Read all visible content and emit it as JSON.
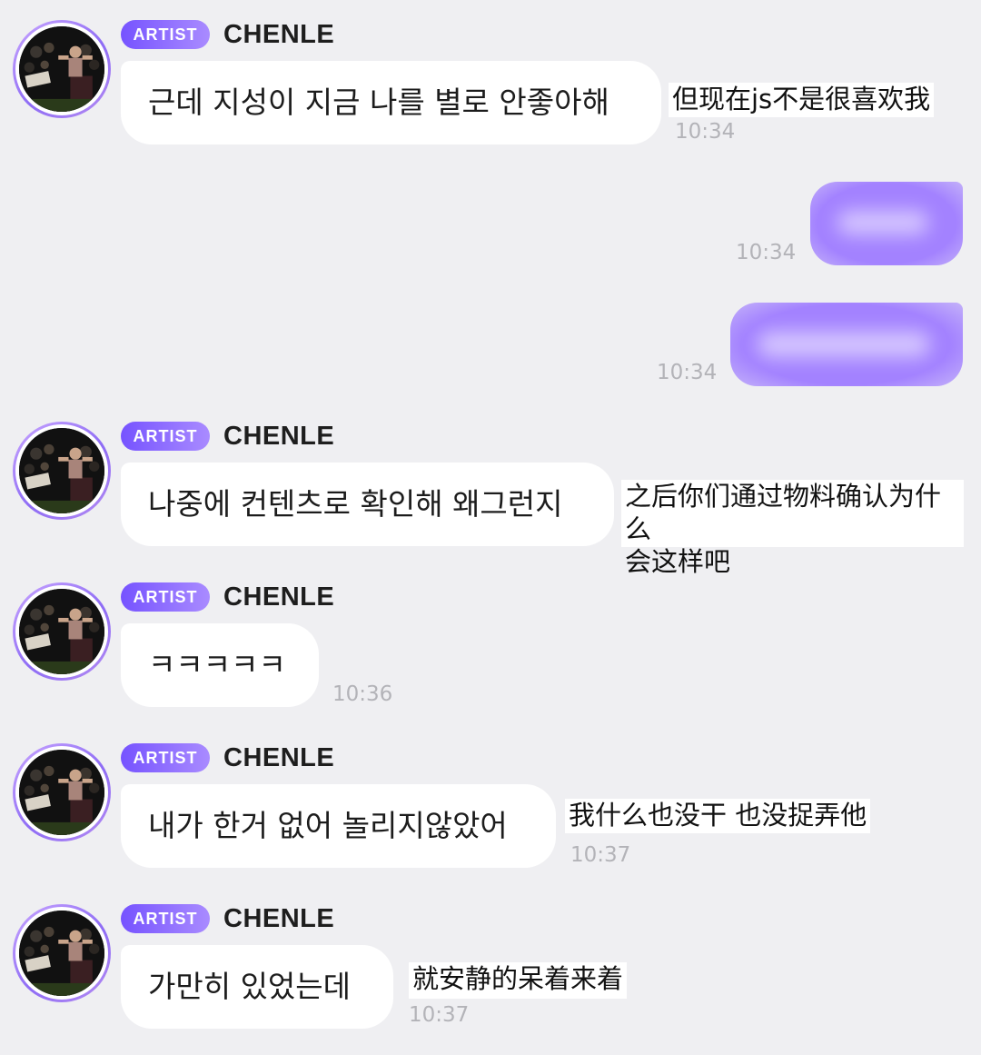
{
  "colors": {
    "background": "#efeff2",
    "badge_gradient_start": "#7653ff",
    "badge_gradient_end": "#a98bff",
    "sent_bubble": "#a382ff",
    "received_bubble": "#ffffff",
    "timestamp": "#b3b3b8"
  },
  "artist": {
    "badge": "ARTIST",
    "name": "CHENLE",
    "avatar_icon": "artist-avatar-photo"
  },
  "messages": [
    {
      "type": "received",
      "text": "근데 지성이 지금 나를 별로 안좋아해",
      "translation": "但现在js不是很喜欢我",
      "time": "10:34"
    },
    {
      "type": "sent",
      "redacted": true,
      "time": "10:34"
    },
    {
      "type": "sent",
      "redacted": true,
      "time": "10:34"
    },
    {
      "type": "received",
      "text": "나중에 컨텐츠로 확인해 왜그런지",
      "translation_line1": "之后你们通过物料确认为什么",
      "translation_line2": "会这样吧"
    },
    {
      "type": "received",
      "text": "ㅋㅋㅋㅋㅋ",
      "time": "10:36"
    },
    {
      "type": "received",
      "text": "내가 한거 없어 놀리지않았어",
      "translation": "我什么也没干 也没捉弄他",
      "time": "10:37"
    },
    {
      "type": "received",
      "text": "가만히 있었는데",
      "translation": "就安静的呆着来着",
      "time": "10:37"
    }
  ]
}
